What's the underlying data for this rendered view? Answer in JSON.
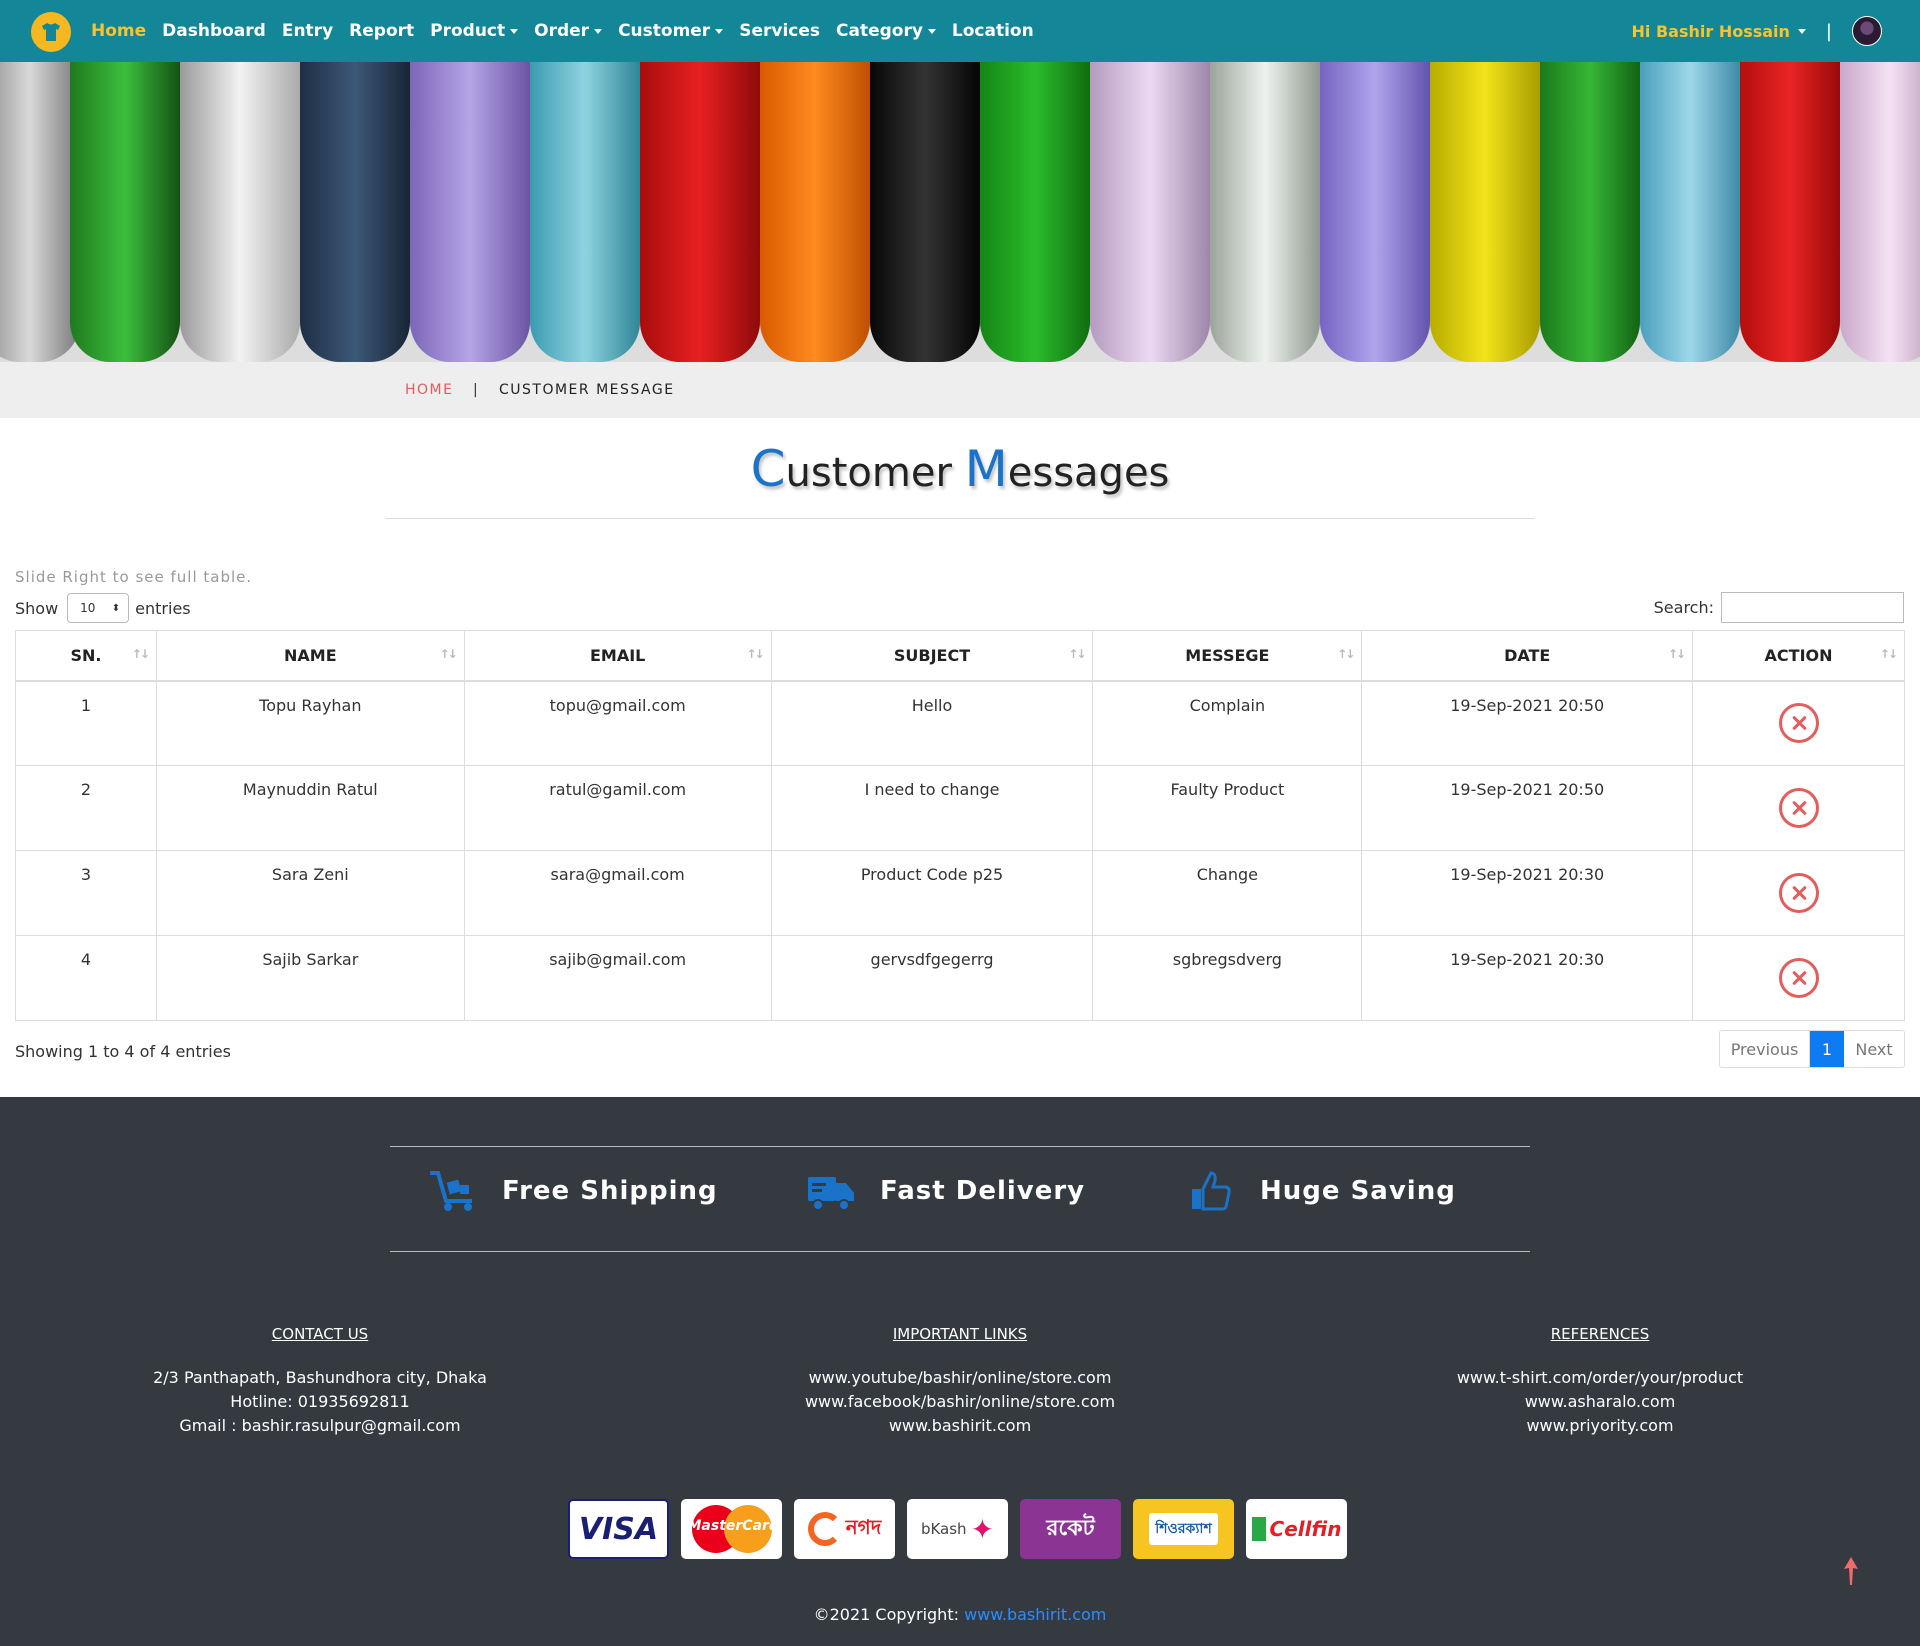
{
  "nav": {
    "items": [
      {
        "label": "Home",
        "dropdown": false,
        "active": true
      },
      {
        "label": "Dashboard",
        "dropdown": false,
        "active": false
      },
      {
        "label": "Entry",
        "dropdown": false,
        "active": false
      },
      {
        "label": "Report",
        "dropdown": false,
        "active": false
      },
      {
        "label": "Product",
        "dropdown": true,
        "active": false
      },
      {
        "label": "Order",
        "dropdown": true,
        "active": false
      },
      {
        "label": "Customer",
        "dropdown": true,
        "active": false
      },
      {
        "label": "Services",
        "dropdown": false,
        "active": false
      },
      {
        "label": "Category",
        "dropdown": true,
        "active": false
      },
      {
        "label": "Location",
        "dropdown": false,
        "active": false
      }
    ],
    "user_greeting": "Hi Bashir Hossain",
    "separator": "|"
  },
  "breadcrumb": {
    "home": "HOME",
    "separator": "|",
    "current": "CUSTOMER MESSAGE"
  },
  "title": {
    "first_cap": "C",
    "first_rest": "ustomer ",
    "second_cap": "M",
    "second_rest": "essages"
  },
  "table": {
    "hint": "Slide Right to see full table.",
    "show_label": "Show",
    "entries_value": "10",
    "entries_label": "entries",
    "search_label": "Search:",
    "columns": [
      "SN.",
      "NAME",
      "EMAIL",
      "SUBJECT",
      "MESSEGE",
      "DATE",
      "ACTION"
    ],
    "rows": [
      {
        "sn": "1",
        "name": "Topu Rayhan",
        "email": "topu@gmail.com",
        "subject": "Hello",
        "message": "Complain",
        "date": "19-Sep-2021 20:50"
      },
      {
        "sn": "2",
        "name": "Maynuddin Ratul",
        "email": "ratul@gamil.com",
        "subject": "I need to change",
        "message": "Faulty Product",
        "date": "19-Sep-2021 20:50"
      },
      {
        "sn": "3",
        "name": "Sara Zeni",
        "email": "sara@gmail.com",
        "subject": "Product Code p25",
        "message": "Change",
        "date": "19-Sep-2021 20:30"
      },
      {
        "sn": "4",
        "name": "Sajib Sarkar",
        "email": "sajib@gmail.com",
        "subject": "gervsdfgegerrg",
        "message": "sgbregsdverg",
        "date": "19-Sep-2021 20:30"
      }
    ],
    "info": "Showing 1 to 4 of 4 entries",
    "pager": {
      "prev": "Previous",
      "current": "1",
      "next": "Next"
    }
  },
  "footer": {
    "features": [
      {
        "label": "Free Shipping",
        "icon": "cart-dolly-icon"
      },
      {
        "label": "Fast Delivery",
        "icon": "truck-icon"
      },
      {
        "label": "Huge Saving",
        "icon": "thumbs-up-icon"
      }
    ],
    "contact": {
      "heading": "CONTACT US",
      "lines": [
        "2/3 Panthapath, Bashundhora city, Dhaka",
        "Hotline: 01935692811",
        "Gmail : bashir.rasulpur@gmail.com"
      ]
    },
    "links": {
      "heading": "IMPORTANT LINKS",
      "lines": [
        "www.youtube/bashir/online/store.com",
        "www.facebook/bashir/online/store.com",
        "www.bashirit.com"
      ]
    },
    "references": {
      "heading": "REFERENCES",
      "lines": [
        "www.t-shirt.com/order/your/product",
        "www.asharalo.com",
        "www.priyority.com"
      ]
    },
    "payments": [
      "VISA",
      "MasterCard",
      "নগদ",
      "bKash",
      "রকেট",
      "শিওরক্যাশ",
      "Cellfin"
    ],
    "copyright_text": "©2021 Copyright: ",
    "copyright_link": "www.bashirit.com"
  },
  "colors": {
    "nav_bg": "#138797",
    "accent_yellow": "#f7c32e",
    "danger": "#e35d5d",
    "primary": "#0d7bf2",
    "footer_bg": "#343a40",
    "title_blue": "#1a73c9"
  }
}
